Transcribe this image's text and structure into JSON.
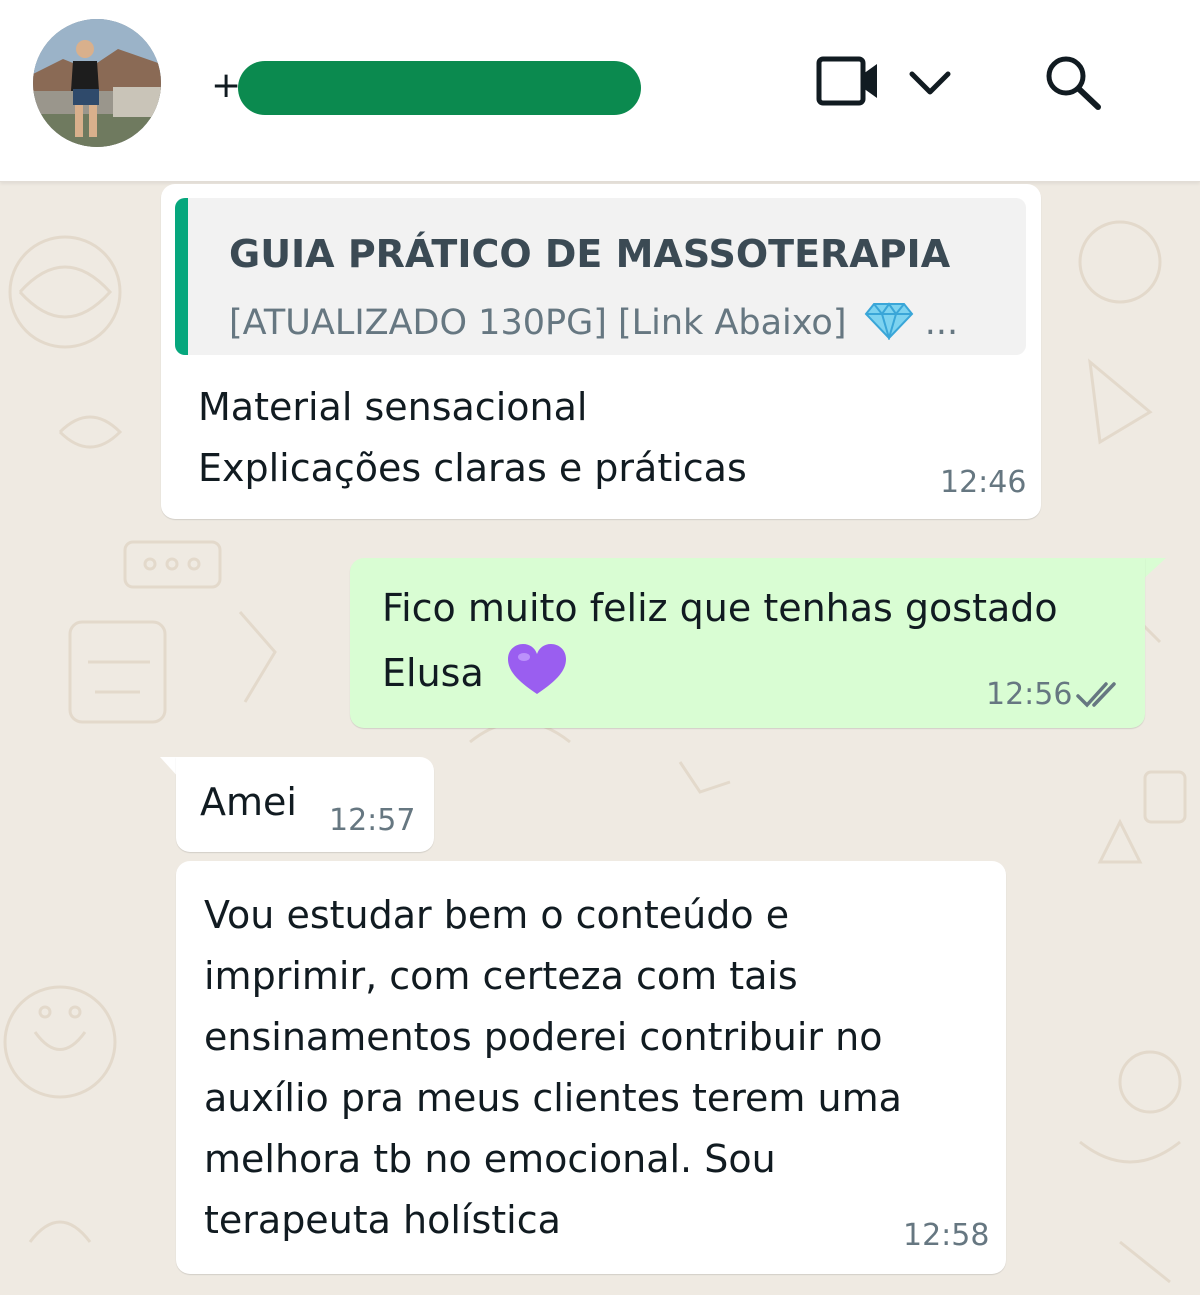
{
  "header": {
    "contact_prefix": "+",
    "icons": [
      "video-call-icon",
      "chevron-down-icon",
      "search-icon"
    ]
  },
  "messages": [
    {
      "direction": "incoming",
      "quote": {
        "title": "GUIA PRÁTICO DE MASSOTERAPIA",
        "subtitle": "[ATUALIZADO 130PG] [Link Abaixo]",
        "subtitle_suffix": "...",
        "emoji": "gem-icon"
      },
      "lines": [
        "Material sensacional",
        "Explicações claras e práticas"
      ],
      "time": "12:46"
    },
    {
      "direction": "outgoing",
      "lines": [
        "Fico muito feliz que tenhas gostado",
        "Elusa"
      ],
      "emoji": "purple-heart-icon",
      "time": "12:56",
      "status": "read"
    },
    {
      "direction": "incoming",
      "lines": [
        "Amei"
      ],
      "time": "12:57"
    },
    {
      "direction": "incoming",
      "lines": [
        "Vou  estudar bem o conteúdo  e",
        "imprimir,  com certeza com tais",
        "ensinamentos  poderei contribuir  no",
        "auxílio pra meus clientes terem uma",
        "melhora tb no emocional. Sou",
        "terapeuta  holística"
      ],
      "time": "12:58"
    }
  ],
  "colors": {
    "background": "#efeae2",
    "incoming_bubble": "#ffffff",
    "outgoing_bubble": "#d9fdd3",
    "quote_accent": "#06a77d",
    "redaction": "#0b8a4f",
    "read_ticks": "#667781"
  }
}
